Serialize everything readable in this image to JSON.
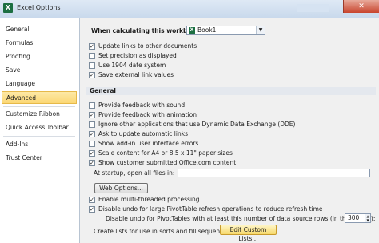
{
  "window": {
    "title": "Excel Options",
    "close_label": "✕"
  },
  "sidebar": {
    "items": [
      {
        "label": "General"
      },
      {
        "label": "Formulas"
      },
      {
        "label": "Proofing"
      },
      {
        "label": "Save"
      },
      {
        "label": "Language"
      },
      {
        "label": "Advanced"
      },
      {
        "label": "Customize Ribbon"
      },
      {
        "label": "Quick Access Toolbar"
      },
      {
        "label": "Add-Ins"
      },
      {
        "label": "Trust Center"
      }
    ],
    "active": "Advanced"
  },
  "workbook": {
    "label": "When calculating this workbook:",
    "selected": "Book1",
    "options": [
      {
        "label": "Update links to other documents",
        "checked": true
      },
      {
        "label": "Set precision as displayed",
        "checked": false
      },
      {
        "label": "Use 1904 date system",
        "checked": false
      },
      {
        "label": "Save external link values",
        "checked": true
      }
    ]
  },
  "general": {
    "header": "General",
    "options": [
      {
        "label": "Provide feedback with sound",
        "checked": false
      },
      {
        "label": "Provide feedback with animation",
        "checked": true
      },
      {
        "label": "Ignore other applications that use Dynamic Data Exchange (DDE)",
        "checked": false
      },
      {
        "label": "Ask to update automatic links",
        "checked": true
      },
      {
        "label": "Show add-in user interface errors",
        "checked": false
      },
      {
        "label": "Scale content for A4 or 8.5 x 11\" paper sizes",
        "checked": true
      },
      {
        "label": "Show customer submitted Office.com content",
        "checked": true
      }
    ],
    "startup_label": "At startup, open all files in:",
    "startup_value": "",
    "web_options_button": "Web Options...",
    "multithread": {
      "label": "Enable multi-threaded processing",
      "checked": true
    },
    "undo_large": {
      "label": "Disable undo for large PivotTable refresh operations to reduce refresh time",
      "checked": true
    },
    "undo_rows_label": "Disable undo for PivotTables with at least this number of data source rows (in thousands):",
    "undo_rows_value": "300",
    "custom_lists_label": "Create lists for use in sorts and fill sequences:",
    "custom_lists_button": "Edit Custom Lists..."
  }
}
